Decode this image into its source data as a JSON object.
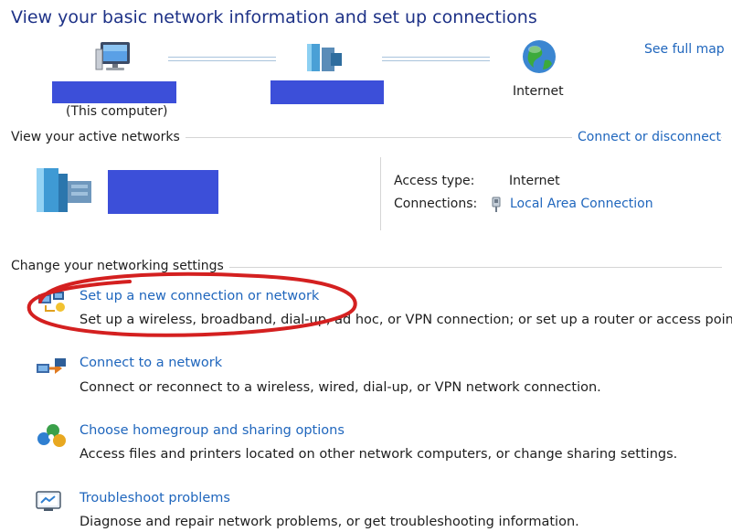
{
  "header": {
    "title": "View your basic network information and set up connections",
    "see_full_map": "See full map"
  },
  "network_map": {
    "computer_caption": "(This computer)",
    "internet_label": "Internet"
  },
  "active_networks": {
    "heading": "View your active networks",
    "connect_or_disconnect": "Connect or disconnect",
    "access_type_label": "Access type:",
    "access_type_value": "Internet",
    "connections_label": "Connections:",
    "connections_value": "Local Area Connection"
  },
  "settings": {
    "heading": "Change your networking settings",
    "items": [
      {
        "label": "Set up a new connection or network",
        "icon": "new-connection-icon",
        "description": "Set up a wireless, broadband, dial-up, ad hoc, or VPN connection; or set up a router or access point."
      },
      {
        "label": "Connect to a network",
        "icon": "connect-network-icon",
        "description": "Connect or reconnect to a wireless, wired, dial-up, or VPN network connection."
      },
      {
        "label": "Choose homegroup and sharing options",
        "icon": "homegroup-icon",
        "description": "Access files and printers located on other network computers, or change sharing settings."
      },
      {
        "label": "Troubleshoot problems",
        "icon": "troubleshoot-icon",
        "description": "Diagnose and repair network problems, or get troubleshooting information."
      }
    ]
  },
  "colors": {
    "title": "#1e3287",
    "link": "#1f66bd",
    "redaction": "#3c4fd9",
    "annotation": "#d42020"
  }
}
